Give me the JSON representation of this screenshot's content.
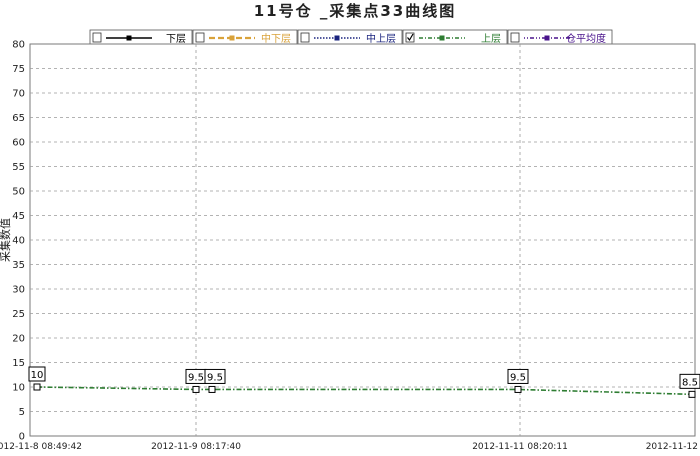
{
  "chart_data": {
    "type": "line",
    "title": "11号仓 _采集点33曲线图",
    "ylabel": "采集数值",
    "xlabel": "",
    "ylim": [
      0,
      80
    ],
    "yticks": [
      0,
      5,
      10,
      15,
      20,
      25,
      30,
      35,
      40,
      45,
      50,
      55,
      60,
      65,
      70,
      75,
      80
    ],
    "grid": true,
    "legend_position": "top",
    "x_tick_labels": [
      "2012-11-8  08:49:42",
      "2012-11-9  08:17:40",
      "2012-11-11  08:20:11",
      "2012-11-12"
    ],
    "x": [
      "2012-11-8 08:49:42",
      "2012-11-9 08:17:40",
      "2012-11-9",
      "2012-11-11 08:20:11",
      "2012-11-12"
    ],
    "series": [
      {
        "name": "下层",
        "values": [],
        "checked": false,
        "color": "#000000"
      },
      {
        "name": "中下层",
        "values": [],
        "checked": false,
        "color": "#d9a23a"
      },
      {
        "name": "中上层",
        "values": [],
        "checked": false,
        "color": "#1a237e"
      },
      {
        "name": "上层",
        "values": [
          10,
          9.5,
          9.5,
          9.5,
          8.5
        ],
        "checked": true,
        "color": "#2e7d32"
      },
      {
        "name": "仓平均度",
        "values": [],
        "checked": false,
        "color": "#4a148c"
      }
    ],
    "data_labels": [
      "10",
      "9.5",
      "9.5",
      "9.5",
      "8.5"
    ]
  }
}
